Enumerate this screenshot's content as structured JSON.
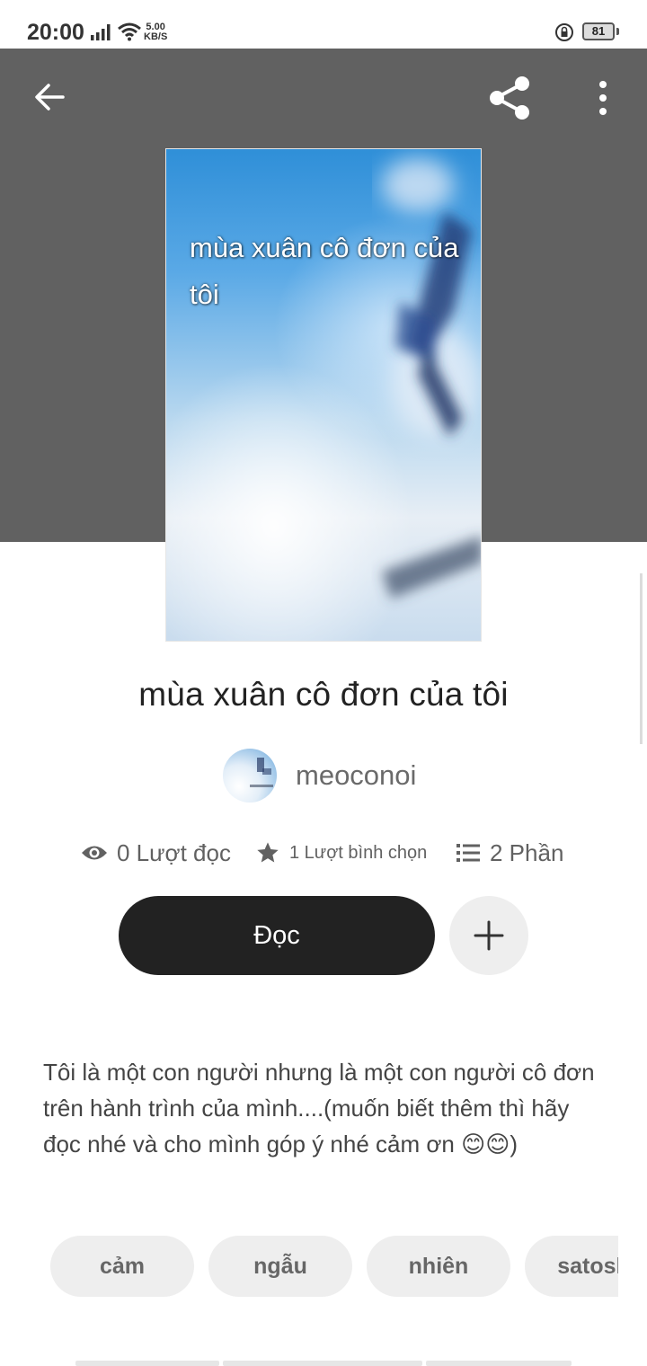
{
  "status_bar": {
    "time": "20:00",
    "net_speed_value": "5.00",
    "net_speed_unit": "KB/S",
    "battery": "81"
  },
  "header": {
    "back_icon": "arrow-left-icon",
    "share_icon": "share-icon",
    "more_icon": "more-vertical-icon",
    "background_color": "#616161"
  },
  "story": {
    "cover_text": "mùa xuân cô đơn của tôi",
    "title": "mùa xuân cô đơn của tôi",
    "author": "meoconoi",
    "stats": {
      "reads": "0 Lượt đọc",
      "votes": "1 Lượt bình chọn",
      "parts": "2 Phần"
    },
    "read_button": "Đọc",
    "add_icon": "plus-icon",
    "description": "Tôi là một con người nhưng là một con người cô đơn trên hành trình của mình....(muốn biết thêm thì hãy đọc nhé và cho mình góp ý nhé cảm ơn 😊😊)",
    "tags": [
      "cảm",
      "ngẫu",
      "nhiên",
      "satoshi"
    ]
  },
  "colors": {
    "primary_button": "#222222",
    "secondary_button": "#eeeeee",
    "tag_background": "#eeeeee"
  }
}
